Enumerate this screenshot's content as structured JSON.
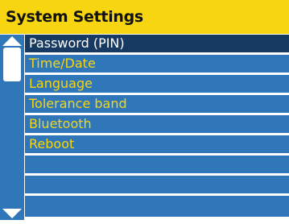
{
  "title": "System Settings",
  "menu": {
    "selected_index": 0,
    "items": [
      {
        "label": "Password (PIN)"
      },
      {
        "label": "Time/Date"
      },
      {
        "label": "Language"
      },
      {
        "label": "Tolerance band"
      },
      {
        "label": "Bluetooth"
      },
      {
        "label": "Reboot"
      },
      {
        "label": ""
      },
      {
        "label": ""
      },
      {
        "label": ""
      }
    ]
  },
  "scrollbar": {
    "up_icon": "triangle-up-icon",
    "down_icon": "triangle-down-icon"
  },
  "colors": {
    "title_background": "#f7d511",
    "menu_background": "#2f77b8",
    "selected_background": "#173a63",
    "menu_text": "#f7d511",
    "selected_text": "#ffffff"
  }
}
